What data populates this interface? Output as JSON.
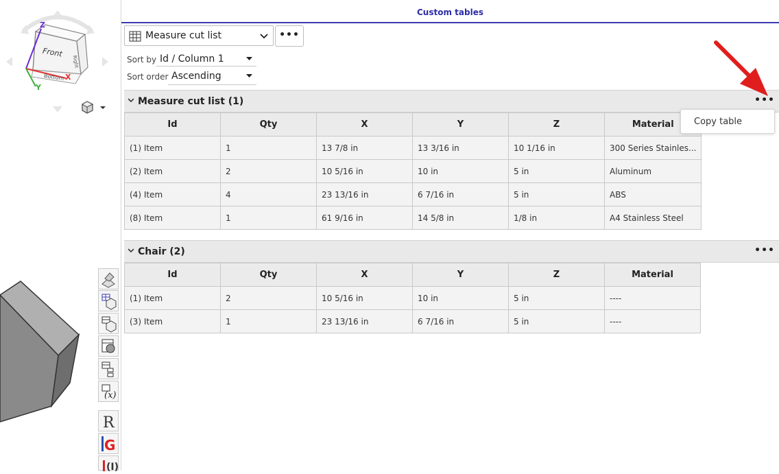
{
  "panel": {
    "title": "Custom tables"
  },
  "table_select": {
    "value": "Measure cut list",
    "more_label": "•••"
  },
  "sort": {
    "sort_by_label": "Sort by",
    "sort_by_value": "Id / Column 1",
    "sort_order_label": "Sort order",
    "sort_order_value": "Ascending"
  },
  "view_cube": {
    "front": "Front",
    "bottom": "Bottom",
    "right": "Right",
    "x": "X",
    "y": "Y",
    "z": "Z"
  },
  "context_menu": {
    "items": [
      "Copy table"
    ]
  },
  "sections": [
    {
      "title": "Measure cut list (1)",
      "columns": [
        "Id",
        "Qty",
        "X",
        "Y",
        "Z",
        "Material"
      ],
      "rows": [
        [
          "(1) Item",
          "1",
          "13 7/8 in",
          "13 3/16 in",
          "10 1/16 in",
          "300 Series Stainles..."
        ],
        [
          "(2) Item",
          "2",
          "10 5/16 in",
          "10 in",
          "5 in",
          "Aluminum"
        ],
        [
          "(4) Item",
          "4",
          "23 13/16 in",
          "6 7/16 in",
          "5 in",
          "ABS"
        ],
        [
          "(8) Item",
          "1",
          "61 9/16 in",
          "14 5/8 in",
          "1/8 in",
          "A4 Stainless Steel"
        ]
      ]
    },
    {
      "title": "Chair (2)",
      "columns": [
        "Id",
        "Qty",
        "X",
        "Y",
        "Z",
        "Material"
      ],
      "rows": [
        [
          "(1) Item",
          "2",
          "10 5/16 in",
          "10 in",
          "5 in",
          "----"
        ],
        [
          "(3) Item",
          "1",
          "23 13/16 in",
          "6 7/16 in",
          "5 in",
          "----"
        ]
      ]
    }
  ],
  "side_toolbar": {
    "icons": [
      "parts-icon",
      "table-cube-icon",
      "table-variable-icon",
      "table-sphere-icon",
      "table-tree-icon",
      "table-function-icon",
      "r-app-icon",
      "g-app-icon",
      "power-app-icon"
    ]
  },
  "colors": {
    "accent": "#2d2da8",
    "arrow": "#e01e1e"
  }
}
